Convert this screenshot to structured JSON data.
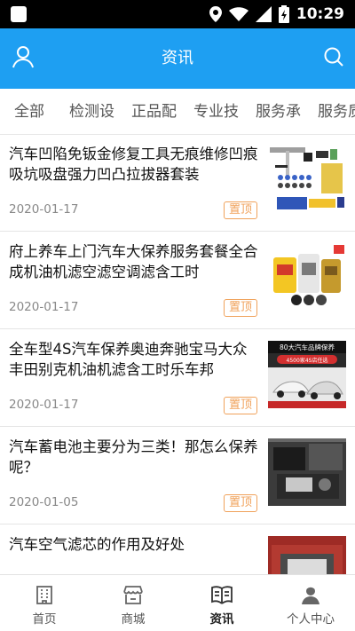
{
  "status_bar": {
    "time": "10:29"
  },
  "header": {
    "title": "资讯"
  },
  "tabs": [
    "全部",
    "检测设",
    "正品配",
    "专业技",
    "服务承",
    "服务质"
  ],
  "news": [
    {
      "title": "汽车凹陷免钣金修复工具无痕维修凹痕吸坑吸盘强力凹凸拉拔器套装",
      "date": "2020-01-17",
      "badge": "置顶"
    },
    {
      "title": "府上养车上门汽车大保养服务套餐全合成机油机滤空滤空调滤含工时",
      "date": "2020-01-17",
      "badge": "置顶"
    },
    {
      "title": "全车型4S汽车保养奥迪奔驰宝马大众丰田别克机油机滤含工时乐车邦",
      "date": "2020-01-17",
      "badge": "置顶",
      "thumb_text_1": "80大汽车品牌保养",
      "thumb_text_2": "4500家4S店任选"
    },
    {
      "title": "汽车蓄电池主要分为三类！那怎么保养呢？",
      "date": "2020-01-05",
      "badge": "置顶"
    },
    {
      "title": "汽车空气滤芯的作用及好处",
      "date": "",
      "badge": ""
    }
  ],
  "bottom_nav": [
    {
      "label": "首页",
      "icon": "building-icon"
    },
    {
      "label": "商城",
      "icon": "shop-icon"
    },
    {
      "label": "资讯",
      "icon": "book-icon"
    },
    {
      "label": "个人中心",
      "icon": "person-icon"
    }
  ],
  "colors": {
    "header": "#1e9ff2",
    "badge": "#f0a25b"
  }
}
